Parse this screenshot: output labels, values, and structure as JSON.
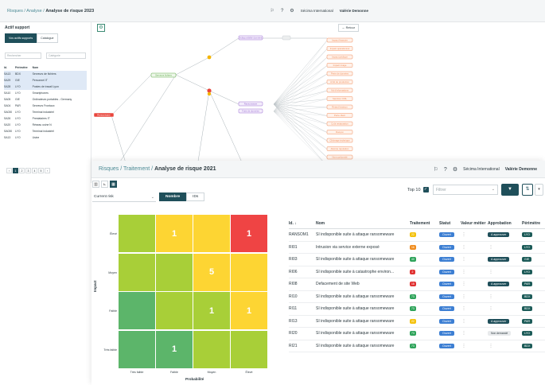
{
  "back": {
    "breadcrumb": [
      "Risques",
      "Analyse"
    ],
    "breadcrumb_current": "Analyse de risque 2023",
    "org": "Sécima International",
    "user": "Valérie Demonne",
    "left_title": "Actif support",
    "tabs": [
      "Vos actifs supports",
      "Catalogue"
    ],
    "filter_placeholder": "Rechercher",
    "category_placeholder": "Catégorie",
    "columns": [
      "Id.",
      "Périmètre",
      "Nom"
    ],
    "rows": [
      {
        "id": "SA13",
        "p": "BDX",
        "nom": "Serveurs de fichiers",
        "sel": true
      },
      {
        "id": "SA29",
        "p": "GIE",
        "nom": "Personnel IT",
        "sel": true
      },
      {
        "id": "SA28",
        "p": "LYO",
        "nom": "Postes de travail Lyon",
        "sel": true
      },
      {
        "id": "SA10",
        "p": "LYO",
        "nom": "Smartphones",
        "sel": false
      },
      {
        "id": "SA05",
        "p": "GIE",
        "nom": "Ordinateurs portables - Germany",
        "sel": false
      },
      {
        "id": "SA04",
        "p": "PAR",
        "nom": "Serveurs Frontaux",
        "sel": false
      },
      {
        "id": "SA030",
        "p": "LYO",
        "nom": "Terminal industriel",
        "sel": false
      },
      {
        "id": "SA26",
        "p": "LYO",
        "nom": "Prestataires IT",
        "sel": false
      },
      {
        "id": "SA20",
        "p": "LYO",
        "nom": "Réseau usine N",
        "sel": false
      },
      {
        "id": "SA030",
        "p": "LYO",
        "nom": "Terminal industriel",
        "sel": false
      },
      {
        "id": "SA13",
        "p": "LYO",
        "nom": "Usine",
        "sel": false
      }
    ],
    "pages": [
      "‹",
      "1",
      "2",
      "3",
      "4",
      "5",
      "›"
    ],
    "retour": "Retour",
    "node_risk": "Ransomware",
    "node_left": "Serveurs fichiers",
    "node_top": "Indisponibilité données",
    "node_mid1": "Ransomware",
    "node_mid2": "Fuite de données",
    "right_nodes": [
      "Impact financier",
      "Impact opérationnel",
      "Impact juridique",
      "Impact image",
      "Perte de données",
      "Arrêt de production",
      "Vol d'informations",
      "Sanction CNIL",
      "Retard livraison",
      "Perte client",
      "Coût restauration",
      "Rançon",
      "Chômage technique",
      "Atteinte réputation",
      "Non-conformité",
      "Perte de CA"
    ]
  },
  "front": {
    "breadcrumb": [
      "Risques",
      "Traitement"
    ],
    "breadcrumb_current": "Analyse de risque 2021",
    "org": "Sécima International",
    "user": "Valérie Demonne",
    "risk_select": "Current risk",
    "seg": [
      "Nombre",
      "IDs"
    ],
    "top10": "Top 10",
    "filter_placeholder": "Filtrer",
    "matrix": {
      "y_axis": "Impact",
      "x_axis": "Probabilité",
      "y_labels": [
        "Élevé",
        "Moyen",
        "Faible",
        "Très faible"
      ],
      "x_labels": [
        "Très faible",
        "Faible",
        "Moyen",
        "Élevé"
      ],
      "cells": [
        [
          {
            "c": "lg",
            "v": ""
          },
          {
            "c": "yl",
            "v": "1"
          },
          {
            "c": "yl",
            "v": ""
          },
          {
            "c": "rd",
            "v": "1"
          }
        ],
        [
          {
            "c": "lg",
            "v": ""
          },
          {
            "c": "lg",
            "v": ""
          },
          {
            "c": "yl",
            "v": "5"
          },
          {
            "c": "yl",
            "v": ""
          }
        ],
        [
          {
            "c": "dg",
            "v": ""
          },
          {
            "c": "lg",
            "v": ""
          },
          {
            "c": "lg",
            "v": "1"
          },
          {
            "c": "yl",
            "v": "1"
          }
        ],
        [
          {
            "c": "dg",
            "v": ""
          },
          {
            "c": "dg",
            "v": "1"
          },
          {
            "c": "lg",
            "v": ""
          },
          {
            "c": "lg",
            "v": ""
          }
        ]
      ]
    },
    "table": {
      "columns": [
        "Id. ↓",
        "Nom",
        "Traitement",
        "Statut",
        "Valeur métier",
        "Approbation",
        "Périmètre"
      ],
      "rows": [
        {
          "id": "RANSOM1",
          "nom": "SI indisponible suite à attaque ransomeware",
          "t": "22",
          "tc": "y",
          "statut": "Ouvert",
          "appro": "A approuver",
          "peri": "LYO"
        },
        {
          "id": "RI01",
          "nom": "Intrusion via service externe exposé",
          "t": "16",
          "tc": "o",
          "statut": "Ouvert",
          "appro": "",
          "peri": "LYO"
        },
        {
          "id": "RI03",
          "nom": "SI indisponible suite à attaque ransomeware",
          "t": "40",
          "tc": "g",
          "statut": "Ouvert",
          "appro": "A approuver",
          "peri": "GIE"
        },
        {
          "id": "RI06",
          "nom": "SI indisponible suite à catastrophe environ...",
          "t": "2",
          "tc": "r",
          "statut": "Ouvert",
          "appro": "",
          "peri": "LYO"
        },
        {
          "id": "RI08",
          "nom": "Defacement de site Web",
          "t": "18",
          "tc": "r",
          "statut": "Ouvert",
          "appro": "A approuver",
          "peri": "PAR"
        },
        {
          "id": "RI10",
          "nom": "SI indisponible suite à attaque ransomeware",
          "t": "73",
          "tc": "g",
          "statut": "Ouvert",
          "appro": "",
          "peri": "BDX"
        },
        {
          "id": "RI11",
          "nom": "SI indisponible suite à attaque ransomeware",
          "t": "73",
          "tc": "g",
          "statut": "Ouvert",
          "appro": "",
          "peri": "BDX"
        },
        {
          "id": "RI13",
          "nom": "SI indisponible suite à attaque ransomeware",
          "t": "22",
          "tc": "y",
          "statut": "Ouvert",
          "appro": "A approuver",
          "peri": "PAR"
        },
        {
          "id": "RI20",
          "nom": "SI indisponible suite à attaque ransomeware",
          "t": "73",
          "tc": "g",
          "statut": "Ouvert",
          "appro": "Non demandé",
          "peri": "LYO"
        },
        {
          "id": "RI21",
          "nom": "SI indisponible suite à attaque ransomeware",
          "t": "73",
          "tc": "g",
          "statut": "Ouvert",
          "appro": "",
          "peri": "BDX"
        }
      ]
    }
  }
}
